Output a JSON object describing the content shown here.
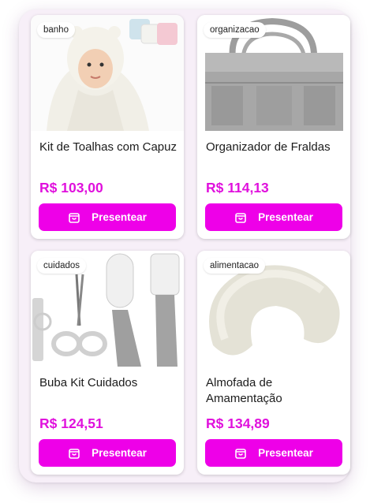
{
  "products": [
    {
      "category": "banho",
      "title": "Kit de Toalhas com Capuz",
      "price": "R$ 103,00",
      "button_label": "Presentear",
      "image": "hooded-towel-photo"
    },
    {
      "category": "organizacao",
      "title": "Organizador de Fraldas",
      "price": "R$ 114,13",
      "button_label": "Presentear",
      "image": "diaper-caddy-photo"
    },
    {
      "category": "cuidados",
      "title": "Buba Kit Cuidados",
      "price": "R$ 124,51",
      "button_label": "Presentear",
      "image": "grooming-kit-photo"
    },
    {
      "category": "alimentacao",
      "title": "Almofada de Amamentação",
      "price": "R$ 134,89",
      "button_label": "Presentear",
      "image": "nursing-pillow-photo"
    }
  ],
  "colors": {
    "accent": "#ee00e8",
    "price": "#e010dd",
    "panel": "#f7eff8"
  },
  "icons": {
    "button": "shopping-bag-icon"
  }
}
